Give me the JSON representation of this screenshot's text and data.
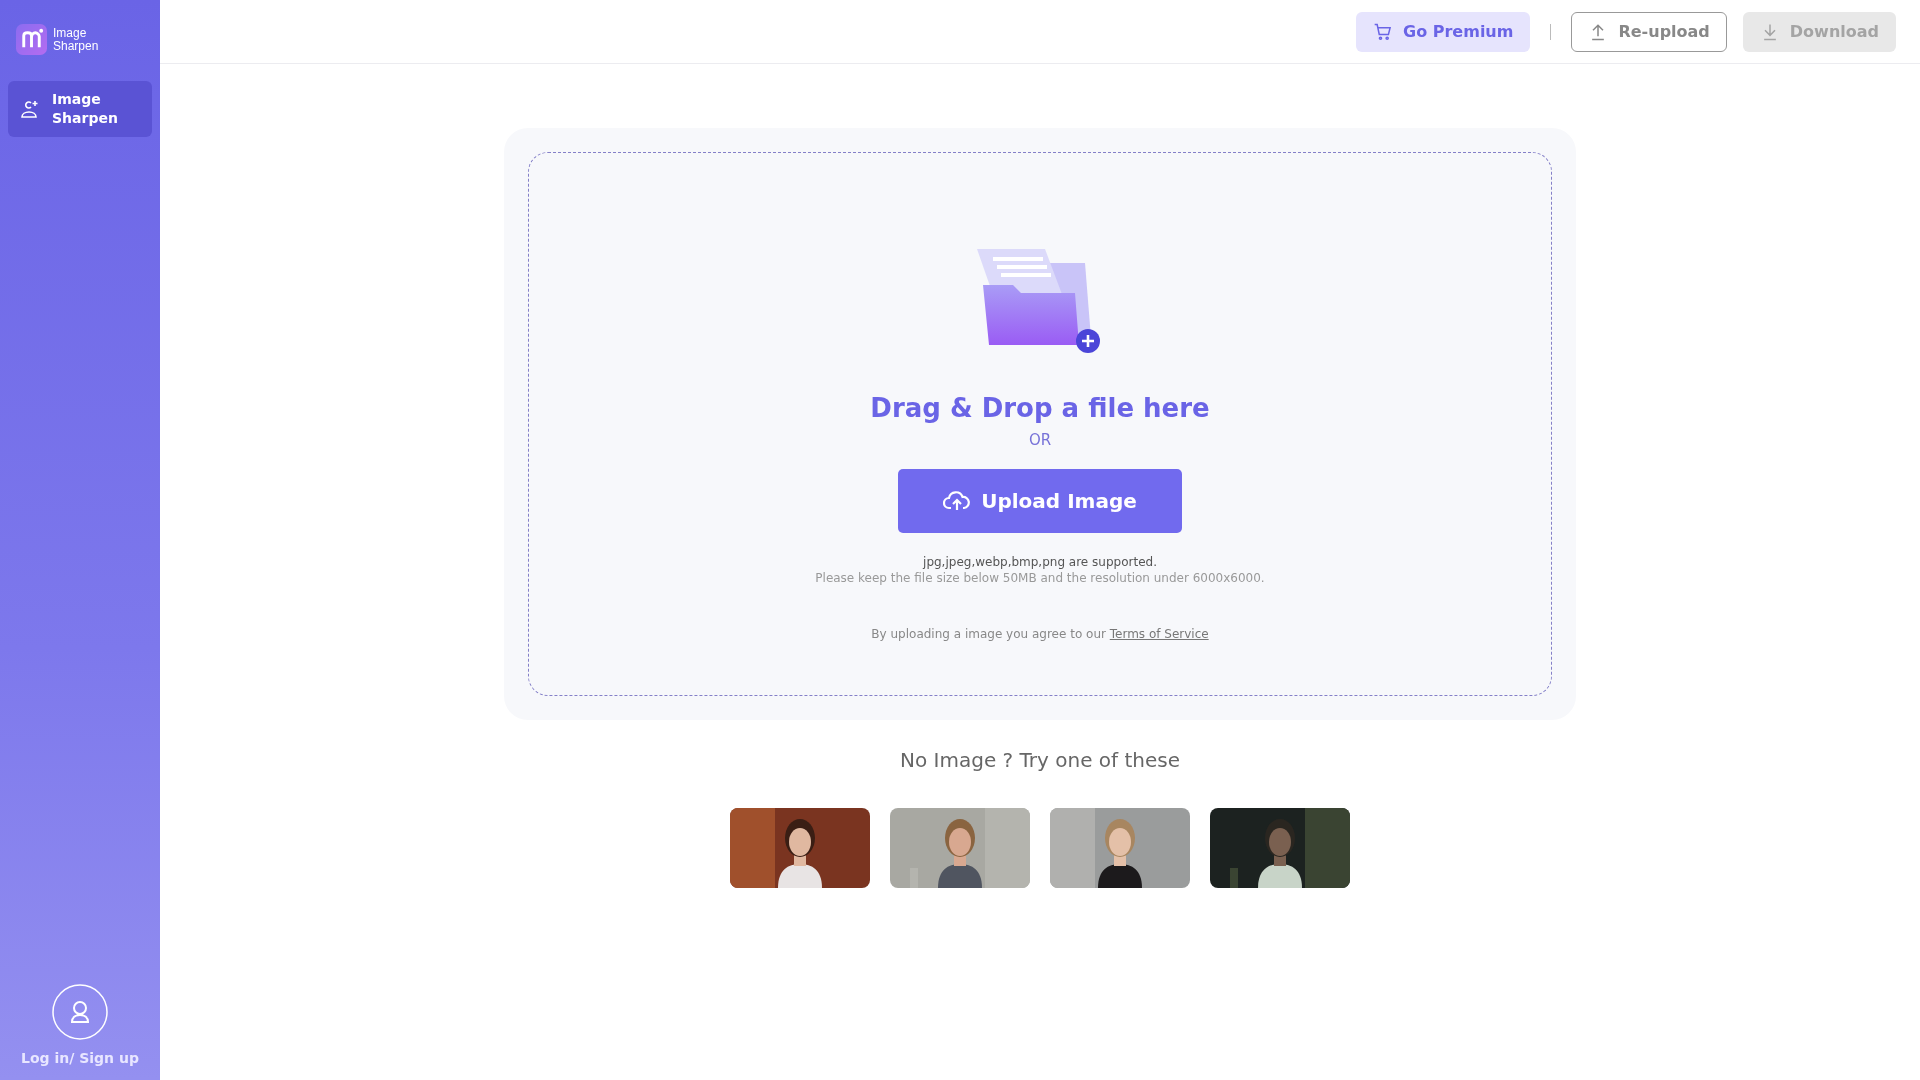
{
  "sidebar": {
    "logo": {
      "text": "Image Sharpen"
    },
    "items": [
      {
        "label": "Image Sharpen",
        "selected": true
      }
    ],
    "account": {
      "label": "Log in/ Sign up"
    }
  },
  "header": {
    "buttons": [
      {
        "kind": "premium",
        "label": "Go Premium",
        "disabled": false
      },
      {
        "kind": "reupload",
        "label": "Re-upload",
        "disabled": false
      },
      {
        "kind": "download",
        "label": "Download",
        "disabled": true
      }
    ]
  },
  "upload": {
    "title": "Drag & Drop a file here",
    "or": "OR",
    "button": "Upload Image",
    "formats": "jpg,jpeg,webp,bmp,png are supported.",
    "limits": "Please keep the file size below 50MB and the resolution under 6000x6000.",
    "terms_prefix": "By uploading a image you agree to our",
    "terms_link": "Terms of Service"
  },
  "samples": {
    "title": "No Image ? Try one of these"
  }
}
